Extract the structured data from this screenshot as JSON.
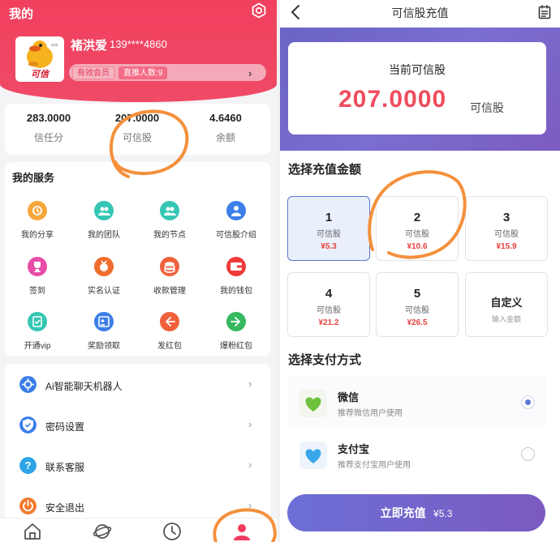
{
  "left": {
    "title": "我的",
    "avatar_text": "可信",
    "user": {
      "name": "褚洪爱",
      "phone": "139****4860"
    },
    "badges": {
      "member": "有效会员",
      "direct": "直推人数:9"
    },
    "stats": [
      {
        "value": "283.0000",
        "label": "信任分"
      },
      {
        "value": "207.0000",
        "label": "可信股"
      },
      {
        "value": "4.6460",
        "label": "余额"
      }
    ],
    "services_title": "我的服务",
    "services": [
      {
        "label": "我的分享",
        "icon": "share-icon",
        "color": "#f7a63a"
      },
      {
        "label": "我的团队",
        "icon": "team-icon",
        "color": "#35c6b4"
      },
      {
        "label": "我的节点",
        "icon": "node-icon",
        "color": "#35c6b4"
      },
      {
        "label": "可信股介绍",
        "icon": "stock-intro-icon",
        "color": "#3b7ee8"
      },
      {
        "label": "签到",
        "icon": "trophy-icon",
        "color": "#e84da8"
      },
      {
        "label": "实名认证",
        "icon": "medal-icon",
        "color": "#f06d2e"
      },
      {
        "label": "收款管理",
        "icon": "coins-icon",
        "color": "#f0613c"
      },
      {
        "label": "我的钱包",
        "icon": "wallet-icon",
        "color": "#ee3b3b"
      },
      {
        "label": "开通vip",
        "icon": "vip-icon",
        "color": "#35c6b4"
      },
      {
        "label": "奖励领取",
        "icon": "reward-card-icon",
        "color": "#3b7ee8"
      },
      {
        "label": "发红包",
        "icon": "send-packet-icon",
        "color": "#f0613c"
      },
      {
        "label": "爆粉红包",
        "icon": "fans-packet-icon",
        "color": "#35b85f"
      }
    ],
    "menu": [
      {
        "label": "Ai智能聊天机器人",
        "icon": "robot-icon",
        "color": "#3b7ee8"
      },
      {
        "label": "密码设置",
        "icon": "shield-icon",
        "color": "#3b7ee8"
      },
      {
        "label": "联系客服",
        "icon": "help-icon",
        "color": "#2ea4e8"
      },
      {
        "label": "安全退出",
        "icon": "power-icon",
        "color": "#f07a2e"
      }
    ]
  },
  "right": {
    "title": "可信股充值",
    "balance": {
      "label": "当前可信股",
      "value": "207.0000",
      "unit": "可信股"
    },
    "amount_section_title": "选择充值金额",
    "amounts": [
      {
        "num": "1",
        "unit": "可信股",
        "price": "¥5.3"
      },
      {
        "num": "2",
        "unit": "可信股",
        "price": "¥10.6"
      },
      {
        "num": "3",
        "unit": "可信股",
        "price": "¥15.9"
      },
      {
        "num": "4",
        "unit": "可信股",
        "price": "¥21.2"
      },
      {
        "num": "5",
        "unit": "可信股",
        "price": "¥26.5"
      }
    ],
    "custom": {
      "label": "自定义",
      "hint": "输入金额"
    },
    "pay_section_title": "选择支付方式",
    "payments": [
      {
        "name": "微信",
        "desc": "推荐微信用户使用",
        "icon": "green-heart-icon"
      },
      {
        "name": "支付宝",
        "desc": "推荐支付宝用户使用",
        "icon": "blue-heart-icon"
      }
    ],
    "submit": {
      "label": "立即充值",
      "price": "¥5.3"
    }
  }
}
